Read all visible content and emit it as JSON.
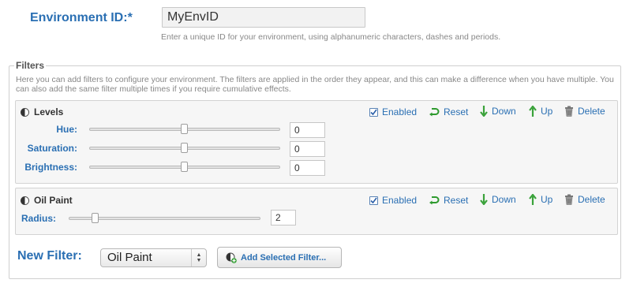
{
  "environment": {
    "label": "Environment ID:*",
    "value": "MyEnvID",
    "hint": "Enter a unique ID for your environment, using alphanumeric characters, dashes and periods."
  },
  "filters": {
    "legend": "Filters",
    "description": "Here you can add filters to configure your environment. The filters are applied in the order they appear, and this can make a difference when you have multiple. You can also add the same filter multiple times if you require cumulative effects.",
    "items": [
      {
        "title": "Levels",
        "enabled_checked": true,
        "actions": {
          "enabled": "Enabled",
          "reset": "Reset",
          "down": "Down",
          "up": "Up",
          "delete": "Delete"
        },
        "params": [
          {
            "label": "Hue:",
            "value": "0",
            "slider_fraction": 0.5
          },
          {
            "label": "Saturation:",
            "value": "0",
            "slider_fraction": 0.5
          },
          {
            "label": "Brightness:",
            "value": "0",
            "slider_fraction": 0.5
          }
        ]
      },
      {
        "title": "Oil Paint",
        "enabled_checked": true,
        "actions": {
          "enabled": "Enabled",
          "reset": "Reset",
          "down": "Down",
          "up": "Up",
          "delete": "Delete"
        },
        "params": [
          {
            "label": "Radius:",
            "value": "2",
            "slider_fraction": 0.14
          }
        ]
      }
    ]
  },
  "new_filter": {
    "label": "New Filter:",
    "selected": "Oil Paint",
    "add_button": "Add Selected Filter..."
  },
  "colors": {
    "accent": "#2a6fb3",
    "reset_green": "#2e9a2e",
    "arrow_green": "#3aa23a"
  },
  "icons": {
    "filter": "half-circle-icon",
    "enabled": "checkbox-icon",
    "reset": "green-loop-arrow-icon",
    "down": "green-down-arrow-icon",
    "up": "green-up-arrow-icon",
    "delete": "trash-icon",
    "add": "add-filter-icon"
  }
}
